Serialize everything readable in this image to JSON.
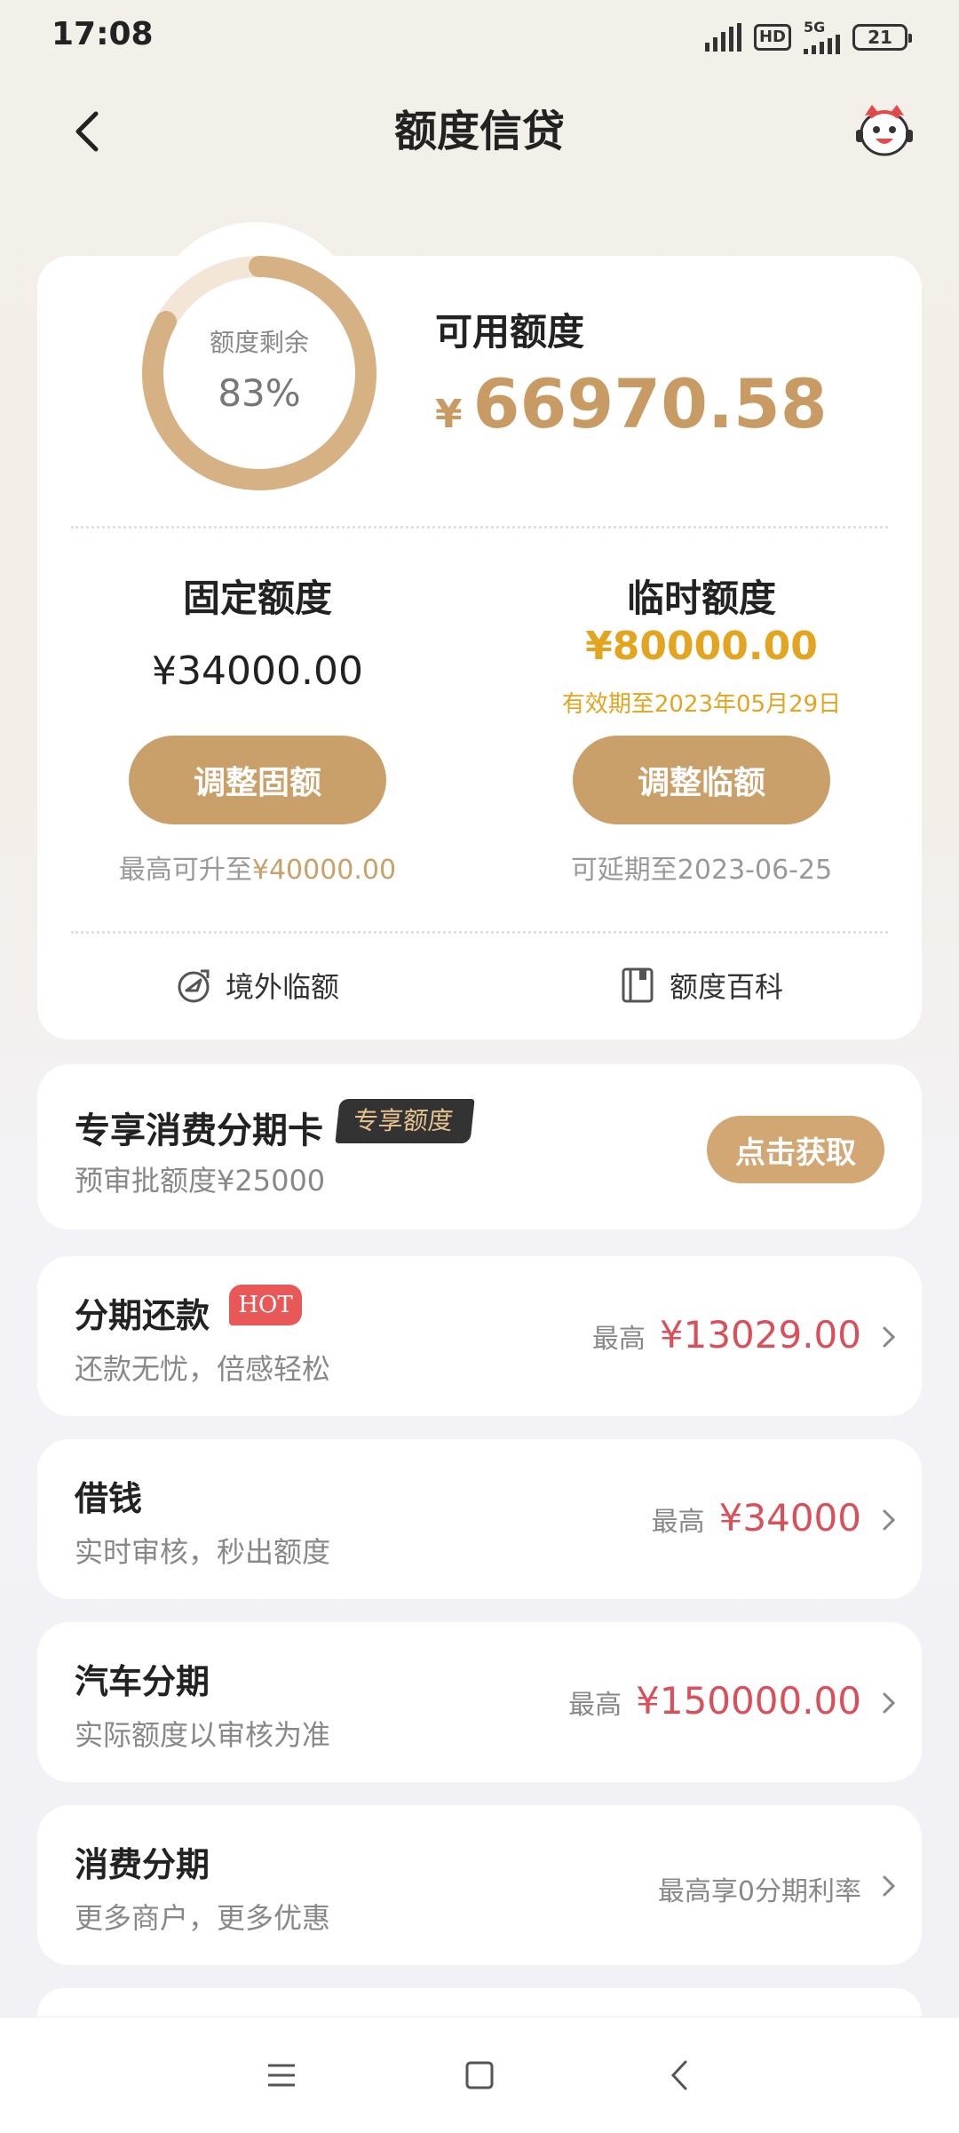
{
  "status_bar": {
    "time": "17:08",
    "hd": "HD",
    "network": "5G",
    "battery": "21"
  },
  "nav": {
    "title": "额度信贷"
  },
  "credit": {
    "ring_label": "额度剩余",
    "ring_percent_text": "83%",
    "ring_fraction": 0.83,
    "available_label": "可用额度",
    "currency": "¥",
    "available_amount": "66970.58"
  },
  "fixed": {
    "title": "固定额度",
    "amount": "¥34000.00",
    "button": "调整固额",
    "note_prefix": "最高可升至",
    "note_value": "¥40000.00"
  },
  "temp": {
    "title": "临时额度",
    "amount": "¥80000.00",
    "valid": "有效期至2023年05月29日",
    "button": "调整临额",
    "note": "可延期至2023-06-25"
  },
  "links": {
    "overseas": "境外临额",
    "wiki": "额度百科"
  },
  "exclusive": {
    "title": "专享消费分期卡",
    "badge": "专享额度",
    "sub": "预审批额度¥25000",
    "button": "点击获取"
  },
  "rows": [
    {
      "title": "分期还款",
      "hot": "HOT",
      "sub": "还款无忧，倍感轻松",
      "label": "最高",
      "value": "¥13029.00"
    },
    {
      "title": "借钱",
      "sub": "实时审核，秒出额度",
      "label": "最高",
      "value": "¥34000"
    },
    {
      "title": "汽车分期",
      "sub": "实际额度以审核为准",
      "label": "最高",
      "value": "¥150000.00"
    },
    {
      "title": "消费分期",
      "sub": "更多商户，更多优惠",
      "label": "最高享0分期利率"
    }
  ],
  "colors": {
    "gold": "#c9a06a",
    "red": "#d9505a",
    "yellow": "#e3a41f"
  }
}
